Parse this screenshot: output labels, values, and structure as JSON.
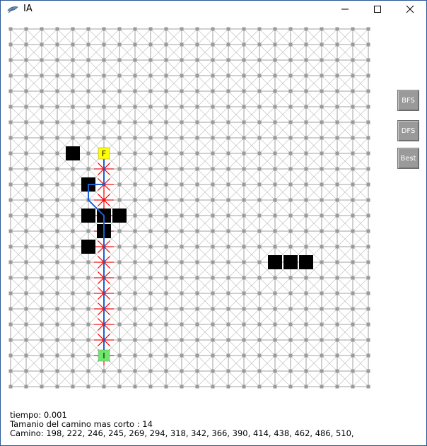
{
  "window": {
    "title": "IA",
    "icon": "feather-icon"
  },
  "buttons": {
    "bfs": "BFS",
    "dfs": "DFS",
    "best": "Best"
  },
  "grid": {
    "size": 24,
    "start": {
      "index": 510,
      "label": "I",
      "color": "#6de86d"
    },
    "finish": {
      "index": 198,
      "label": "F",
      "color": "#ffff00"
    },
    "obstacles": [
      293,
      294,
      295,
      318,
      377,
      378,
      379,
      341,
      196,
      245
    ],
    "path": [
      198,
      222,
      246,
      245,
      269,
      294,
      318,
      342,
      366,
      390,
      414,
      438,
      462,
      486,
      510
    ],
    "expanded": [
      222,
      246,
      270,
      294,
      318,
      342,
      366,
      390,
      414,
      438,
      462,
      486,
      510
    ],
    "colors": {
      "grid": "#a0a0a0",
      "path": "#1a5fd6",
      "expanded": "#ff0000",
      "obstacle": "#000000"
    }
  },
  "info": {
    "time": "tiempo: 0.001",
    "size": "Tamanio del camino mas corto : 14",
    "path": "Camino: 198, 222, 246, 245, 269, 294, 318, 342, 366, 390, 414, 438, 462, 486, 510,"
  }
}
